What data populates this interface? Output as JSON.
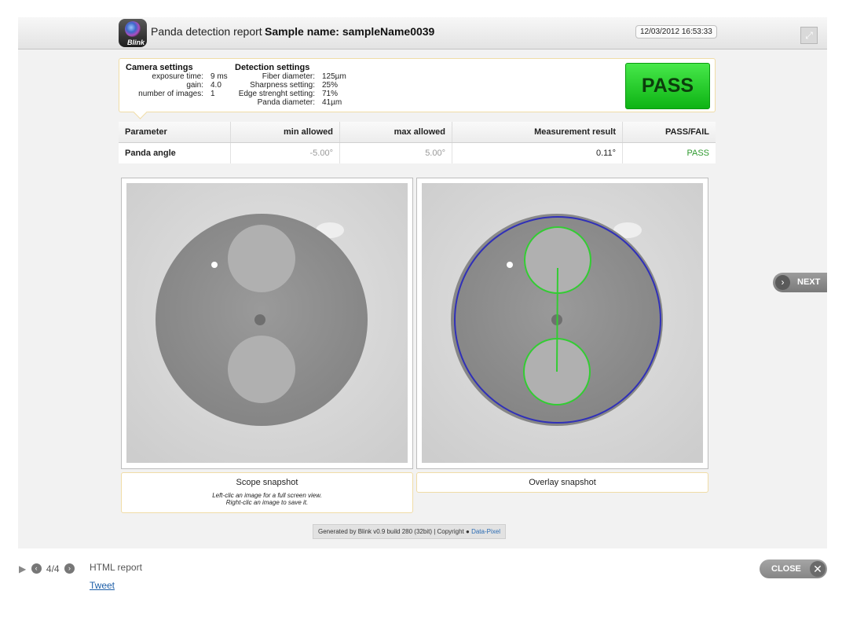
{
  "header": {
    "logo_text": "Blink",
    "title": "Panda detection report",
    "sample_name": "Sample name: sampleName0039",
    "datetime": "12/03/2012 16:53:33",
    "expand_icon": "expand-icon"
  },
  "camera_settings": {
    "heading": "Camera settings",
    "rows": [
      {
        "label": "exposure time:",
        "value": "9 ms"
      },
      {
        "label": "gain:",
        "value": "4.0"
      },
      {
        "label": "number of images:",
        "value": "1"
      }
    ]
  },
  "detection_settings": {
    "heading": "Detection settings",
    "rows": [
      {
        "label": "Fiber diameter:",
        "value": "125µm"
      },
      {
        "label": "Sharpness setting:",
        "value": "25%"
      },
      {
        "label": "Edge strenght setting:",
        "value": "71%"
      },
      {
        "label": "Panda diameter:",
        "value": "41µm"
      }
    ]
  },
  "result_badge": {
    "label": "PASS",
    "color": "#18c21c"
  },
  "table": {
    "headers": [
      "Parameter",
      "min allowed",
      "max allowed",
      "Measurement result",
      "PASS/FAIL"
    ],
    "rows": [
      {
        "parameter": "Panda angle",
        "min": "-5.00°",
        "max": "5.00°",
        "result": "0.11°",
        "status": "PASS"
      }
    ]
  },
  "snapshots": {
    "scope_caption": "Scope snapshot",
    "overlay_caption": "Overlay snapshot",
    "hint_line1": "Left-clic an image for a full screen view.",
    "hint_line2": "Right-clic an image to save it."
  },
  "footer": {
    "generated": "Generated by Blink v0.9 build 280 (32bit) | Copyright",
    "company": "Data-Pixel"
  },
  "lightbox": {
    "next_label": "NEXT",
    "counter": "4/4",
    "report_title": "HTML report",
    "tweet_label": "Tweet",
    "close_label": "CLOSE"
  }
}
